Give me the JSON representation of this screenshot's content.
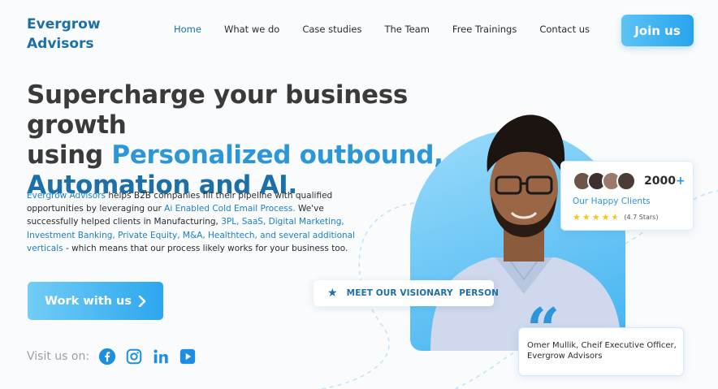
{
  "brand": {
    "line1": "Evergrow",
    "line2": "Advisors"
  },
  "nav": {
    "items": [
      "Home",
      "What we do",
      "Case studies",
      "The Team",
      "Free Trainings",
      "Contact us"
    ],
    "active": "Home"
  },
  "join_button": "Join us",
  "hero": {
    "line1": "Supercharge your business growth",
    "line2_prefix": "using ",
    "line2_highlight": "Personalized outbound,",
    "line3": "Automation and AI."
  },
  "description": {
    "brand": "Evergrow Advisors",
    "part1": " helps B2B companies fill their pipeline with qualified opportunities by leveraging our ",
    "process": "Ai Enabled Cold Email Process.",
    "part2": " We've successfully helped clients in Manufacturing, ",
    "verticals": "3PL, SaaS, Digital Marketing, Investment Banking, Private Equity, M&A, Healthtech, and several additional verticals",
    "part3": " - which means that our process likely works for your business too."
  },
  "work_button": "Work with us",
  "social": {
    "label": "Visit us on:",
    "icons": [
      "facebook-icon",
      "instagram-icon",
      "linkedin-icon",
      "youtube-icon"
    ]
  },
  "clients": {
    "count": "2000",
    "plus": "+",
    "label": "Our Happy Clients",
    "rating_text": "(4.7 Stars)",
    "rating": 4.7
  },
  "meet_badge": "MEET OUR VISIONARY  PERSON",
  "quote": {
    "line1": "Omer Mullik, Cheif Executive Officer,",
    "line2": "Evergrow Advisors"
  },
  "colors": {
    "brand_blue": "#1d6fa8",
    "accent_blue": "#2b96d9",
    "button_gradient_start": "#5cc3f5",
    "button_gradient_end": "#27a3ee",
    "star": "#f5c518"
  }
}
